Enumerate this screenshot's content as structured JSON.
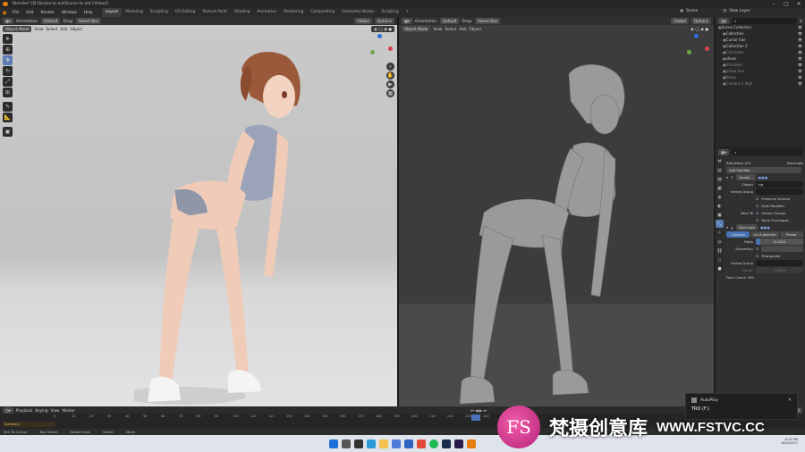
{
  "window": {
    "title": "Blender* [D:\\Scene to out\\Scene to out [Video]]"
  },
  "menu": [
    "File",
    "Edit",
    "Render",
    "Window",
    "Help"
  ],
  "workspaces": [
    "Layout",
    "Modeling",
    "Sculpting",
    "UV Editing",
    "Texture Paint",
    "Shading",
    "Animation",
    "Rendering",
    "Compositing",
    "Geometry Nodes",
    "Scripting"
  ],
  "top_right": {
    "scene": "Scene",
    "view_layer": "View Layer"
  },
  "viewport_left": {
    "header": {
      "orientation_label": "Orientation:",
      "orientation_value": "Default",
      "drag_label": "Drag:",
      "drag_value": "Select Box",
      "transform_value": "Global",
      "options": "Options"
    },
    "mode": "Object Mode",
    "menus": [
      "View",
      "Select",
      "Add",
      "Object"
    ]
  },
  "viewport_right": {
    "header": {
      "orientation_label": "Orientation:",
      "orientation_value": "Default",
      "drag_label": "Drag:",
      "drag_value": "Select Box",
      "transform_value": "Global",
      "options": "Options"
    },
    "mode": "Object Mode",
    "menus": [
      "View",
      "Select",
      "Add",
      "Object"
    ]
  },
  "outliner": {
    "items": [
      {
        "label": "Scene Collection",
        "color": "#cfcfcf"
      },
      {
        "label": "Collection",
        "color": "#cfcfcf"
      },
      {
        "label": "Cursor hair",
        "color": "#cfcfcf"
      },
      {
        "label": "Collection 3",
        "color": "#cfcfcf"
      },
      {
        "label": "Character",
        "color": "#8a8a8a"
      },
      {
        "label": "shoes",
        "color": "#cfcfcf"
      },
      {
        "label": "Shadows",
        "color": "#8a8a8a"
      },
      {
        "label": "pillow hair",
        "color": "#8a8a8a"
      },
      {
        "label": "Plane",
        "color": "#8a8a8a"
      },
      {
        "label": "Camera 2 high",
        "color": "#8a8a8a"
      }
    ]
  },
  "properties": {
    "object_name": "BodyMesh.001",
    "modifier_name": "Decimate",
    "add_modifier": "Add Modifier",
    "armature": {
      "name": "Armat...",
      "object_label": "Object",
      "object_value": "rig",
      "vertex_group_label": "Vertex Group",
      "preserve_volume": "Preserve Volume",
      "multi_modifier": "Multi Modifier",
      "bind_to_label": "Bind To",
      "vertex_groups": "Vertex Groups",
      "bone_envelopes": "Bone Envelopes"
    },
    "decimate": {
      "name": "Decimate",
      "tabs": [
        "Collapse",
        "Un-Subdivide",
        "Planar"
      ],
      "ratio_label": "Ratio",
      "ratio_value": "0.1000",
      "ratio_fraction": 0.1,
      "symmetry_label": "Symmetry",
      "triangulate": "Triangulate",
      "vertex_group_label": "Vertex Group",
      "factor_label": "Factor",
      "factor_value": "1.0000",
      "face_count": "Face Count: 459"
    }
  },
  "timeline": {
    "menus": [
      "Playback",
      "Keying",
      "View",
      "Marker"
    ],
    "frame_current": "236",
    "start_label": "Start",
    "start_value": "1",
    "end_label": "End",
    "end_value": "250",
    "ticks": [
      "0",
      "10",
      "20",
      "30",
      "40",
      "50",
      "60",
      "70",
      "80",
      "90",
      "100",
      "110",
      "120",
      "130",
      "140",
      "150",
      "160",
      "170",
      "180",
      "190",
      "200",
      "210",
      "220",
      "230",
      "240",
      "250"
    ],
    "summary_label": "Summary"
  },
  "statusbar": [
    "Set 3D Cursor",
    "Box Select",
    "Rotate View",
    "Select",
    "Move"
  ],
  "notification": {
    "title": "AutoPlay",
    "line": "TRO (F:)"
  },
  "watermark": {
    "brand": "FS",
    "name": "梵摄创意库",
    "url": "WWW.FSTVC.CC"
  },
  "taskbar": {
    "time": "8:23 PM",
    "date": "6/24/2021"
  }
}
